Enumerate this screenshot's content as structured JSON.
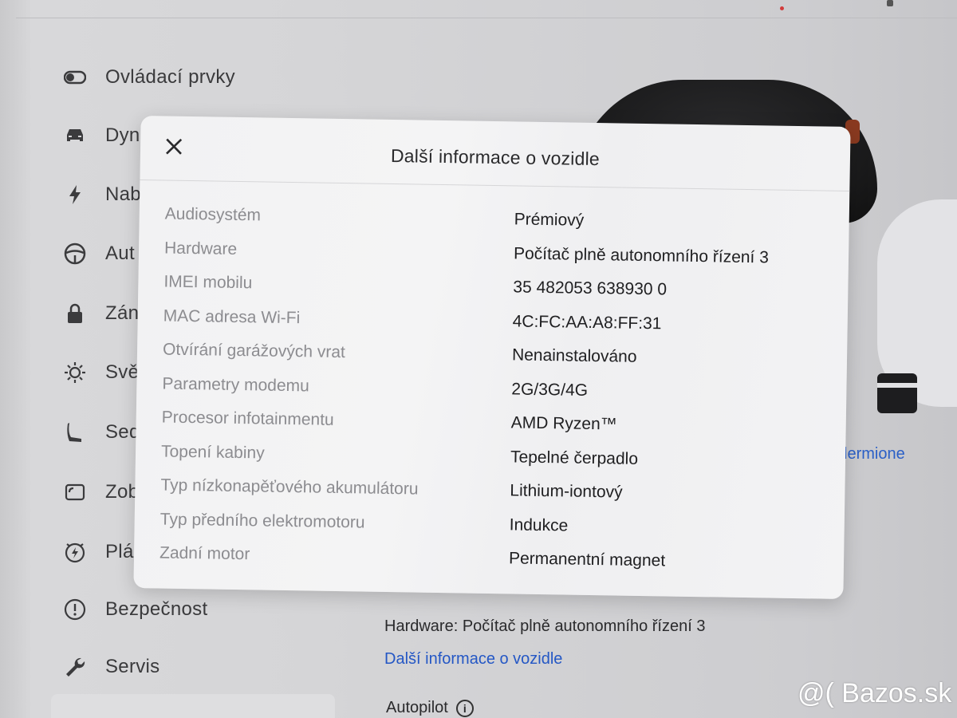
{
  "sidebar": {
    "items": [
      {
        "label": "Ovládací prvky",
        "icon": "toggle-icon"
      },
      {
        "label": "Dyn",
        "icon": "car-icon"
      },
      {
        "label": "Nab",
        "icon": "bolt-icon"
      },
      {
        "label": "Aut",
        "icon": "steering-wheel-icon"
      },
      {
        "label": "Zán",
        "icon": "lock-icon"
      },
      {
        "label": "Svě",
        "icon": "sun-icon"
      },
      {
        "label": "Sed",
        "icon": "seat-icon"
      },
      {
        "label": "Zob",
        "icon": "display-icon"
      },
      {
        "label": "Plá",
        "icon": "schedule-icon"
      },
      {
        "label": "Bezpečnost",
        "icon": "alert-icon"
      },
      {
        "label": "Servis",
        "icon": "wrench-icon"
      }
    ]
  },
  "background": {
    "hardware_text": "Hardware: Počítač plně autonomního řízení 3",
    "more_info_link": "Další informace o vozidle",
    "autopilot_label": "Autopilot",
    "profile_name_partial": "lermione"
  },
  "modal": {
    "title": "Další informace o vozidle",
    "rows": [
      {
        "key": "Audiosystém",
        "value": "Prémiový"
      },
      {
        "key": "Hardware",
        "value": "Počítač plně autonomního řízení 3"
      },
      {
        "key": "IMEI mobilu",
        "value": "35 482053 638930 0"
      },
      {
        "key": "MAC adresa Wi-Fi",
        "value": "4C:FC:AA:A8:FF:31"
      },
      {
        "key": "Otvírání garážových vrat",
        "value": "Nenainstalováno"
      },
      {
        "key": "Parametry modemu",
        "value": "2G/3G/4G"
      },
      {
        "key": "Procesor infotainmentu",
        "value": "AMD Ryzen™"
      },
      {
        "key": "Topení kabiny",
        "value": "Tepelné čerpadlo"
      },
      {
        "key": "Typ nízkonapěťového akumulátoru",
        "value": "Lithium-iontový"
      },
      {
        "key": "Typ předního elektromotoru",
        "value": "Indukce"
      },
      {
        "key": "Zadní motor",
        "value": "Permanentní magnet"
      }
    ]
  },
  "watermark": "@( Bazos.sk",
  "colors": {
    "link": "#2457c5",
    "key_text": "#8c8c90",
    "value_text": "#1f1f21",
    "modal_bg": "#f3f3f4"
  }
}
